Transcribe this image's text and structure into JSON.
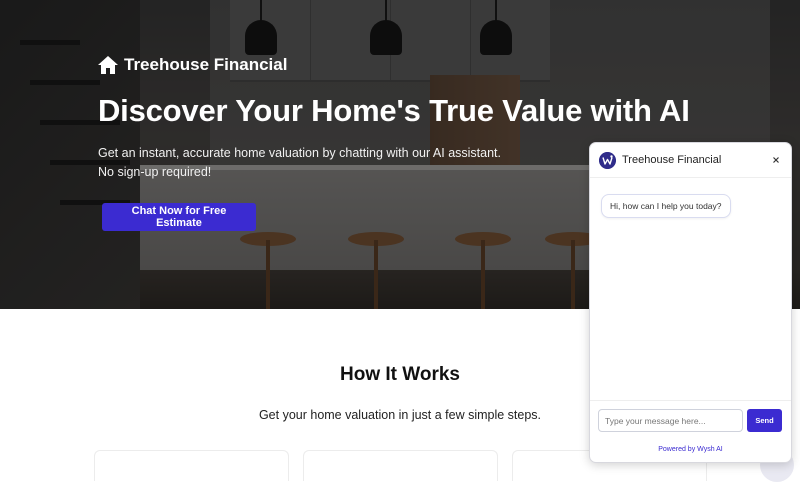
{
  "brand": {
    "name": "Treehouse Financial",
    "icon": "home-icon",
    "color": "#ffffff"
  },
  "hero": {
    "title": "Discover Your Home's True Value with AI",
    "subtitle_line1": "Get an instant, accurate home valuation by chatting with our AI assistant.",
    "subtitle_line2": "No sign-up required!",
    "cta_label": "Chat Now for Free Estimate"
  },
  "how_it_works": {
    "title": "How It Works",
    "subtitle": "Get your home valuation in just a few simple steps."
  },
  "chat": {
    "title": "Treehouse Financial",
    "logo_icon": "wysh-logo-icon",
    "close_icon": "close-icon",
    "greeting": "Hi, how can I help you today?",
    "input_placeholder": "Type your message here...",
    "input_value": "",
    "send_label": "Send",
    "powered_by": "Powered by Wysh AI"
  },
  "colors": {
    "accent": "#3b2bd1",
    "chat_logo": "#2f2c8a",
    "text_dark": "#111111"
  }
}
